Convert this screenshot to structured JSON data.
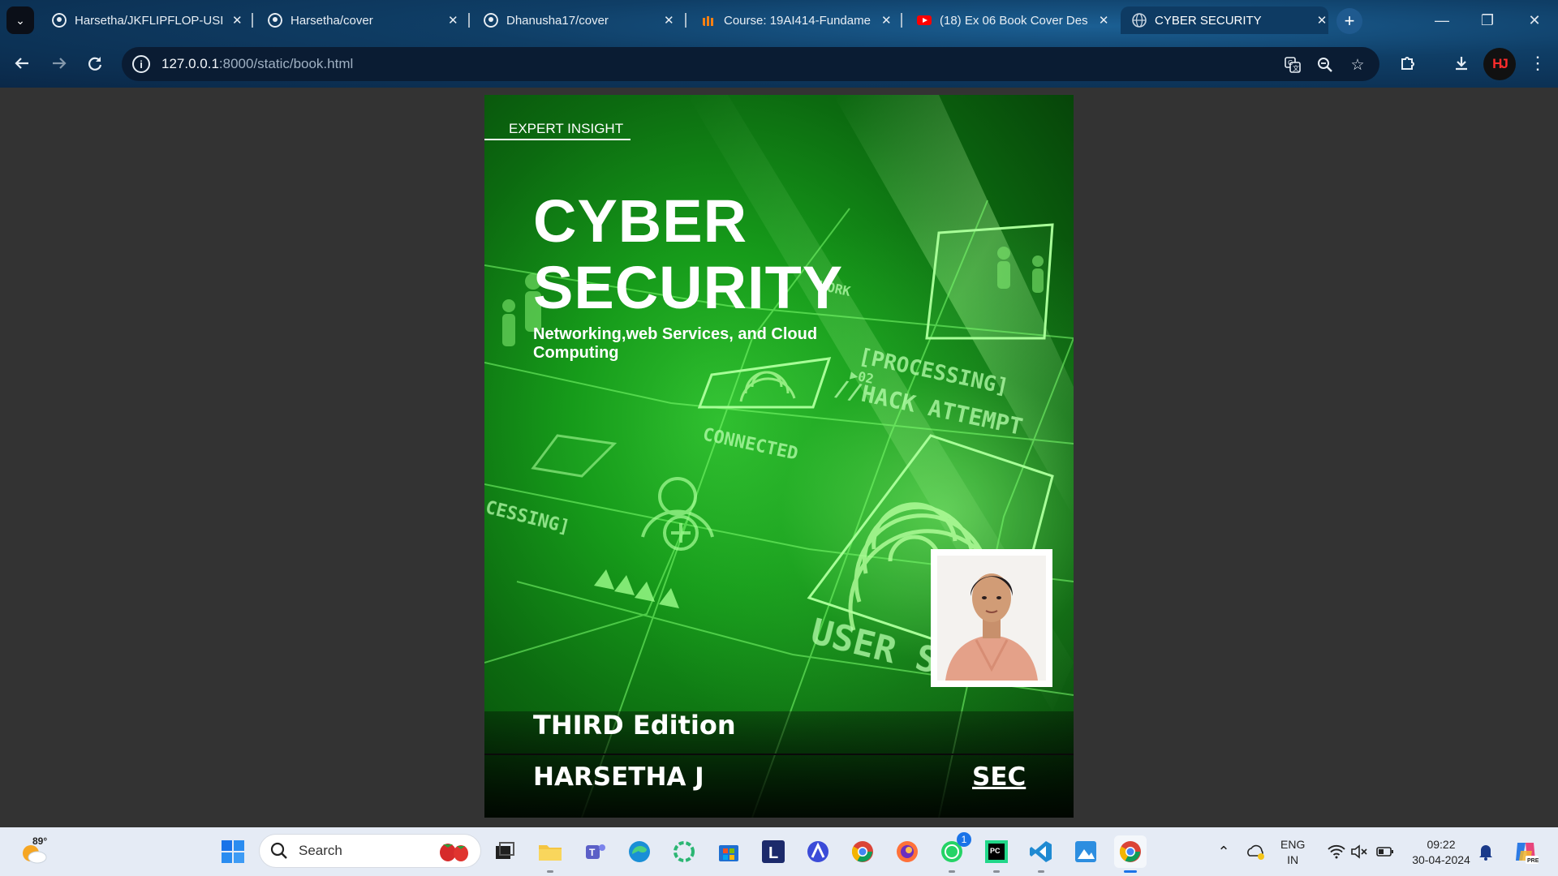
{
  "browser": {
    "tabs": [
      {
        "label": "Harsetha/JKFLIPFLOP-USIN",
        "icon": "github-icon"
      },
      {
        "label": "Harsetha/cover",
        "icon": "github-icon"
      },
      {
        "label": "Dhanusha17/cover",
        "icon": "github-icon"
      },
      {
        "label": "Course: 19AI414-Fundame",
        "icon": "moodle-icon"
      },
      {
        "label": "(18) Ex 06 Book Cover Des",
        "icon": "youtube-icon"
      },
      {
        "label": "CYBER SECURITY",
        "icon": "globe-icon",
        "active": true
      }
    ],
    "close_glyph": "✕",
    "new_tab_glyph": "+",
    "url_host": "127.0.0.1",
    "url_rest": ":8000/static/book.html",
    "profile_initials": "HJ",
    "colors": {
      "frame": "#0f3e66",
      "omnibox": "#0a1c33"
    }
  },
  "cover": {
    "badge": "EXPERT INSIGHT",
    "title_line1": "CYBER",
    "title_line2": "SECURITY",
    "subtitle": "Networking,web Services, and Cloud Computing",
    "edition": "THIRD Edition",
    "author": "HARSETHA J",
    "publisher": "SEC",
    "art_text": [
      "[PROCESSING]",
      "▶02",
      "//HACK ATTEMPT",
      "CONNECTED",
      "USER S",
      "WORK",
      "CESSING]"
    ],
    "colors": {
      "background": "#333333",
      "cover_green": "#169b1a"
    }
  },
  "taskbar": {
    "weather": "89°",
    "search_label": "Search",
    "apps": [
      "windows-start",
      "search",
      "task-view",
      "file-explorer",
      "teams",
      "edge",
      "app-circle",
      "microsoft-store",
      "L-app",
      "app-triangle",
      "chrome",
      "firefox",
      "whatsapp",
      "pycharm",
      "vscode",
      "app-blue",
      "chrome-active"
    ],
    "whatsapp_badge": "1",
    "lang_line1": "ENG",
    "lang_line2": "IN",
    "time": "09:22",
    "date": "30-04-2024"
  }
}
